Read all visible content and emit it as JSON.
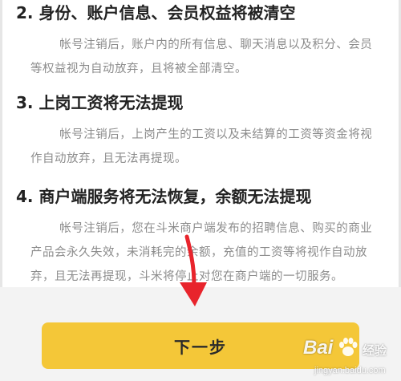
{
  "sections": [
    {
      "title": "2. 身份、账户信息、会员权益将被清空",
      "body": "帐号注销后，账户内的所有信息、聊天消息以及积分、会员等权益视为自动放弃，且将被全部清空。"
    },
    {
      "title": "3. 上岗工资将无法提现",
      "body": "帐号注销后，上岗产生的工资以及未结算的工资等资金将视作自动放弃，且无法再提现。"
    },
    {
      "title": "4. 商户端服务将无法恢复，余额无法提现",
      "body": "帐号注销后，您在斗米商户端发布的招聘信息、购买的商业产品会永久失效，未消耗完的余额，充值的工资等将视作自动放弃，且无法再提现，斗米将停止对您在商户端的一切服务。"
    }
  ],
  "footer": {
    "next_button_label": "下一步"
  },
  "watermark": {
    "brand": "Bai",
    "label": "经验",
    "url": "jingyan.baidu.com"
  },
  "colors": {
    "accent_button": "#f4c738",
    "annotation_arrow": "#e8242c",
    "body_text": "#8c8c8c",
    "title_text": "#222222",
    "footer_background": "#f3f3f3"
  }
}
